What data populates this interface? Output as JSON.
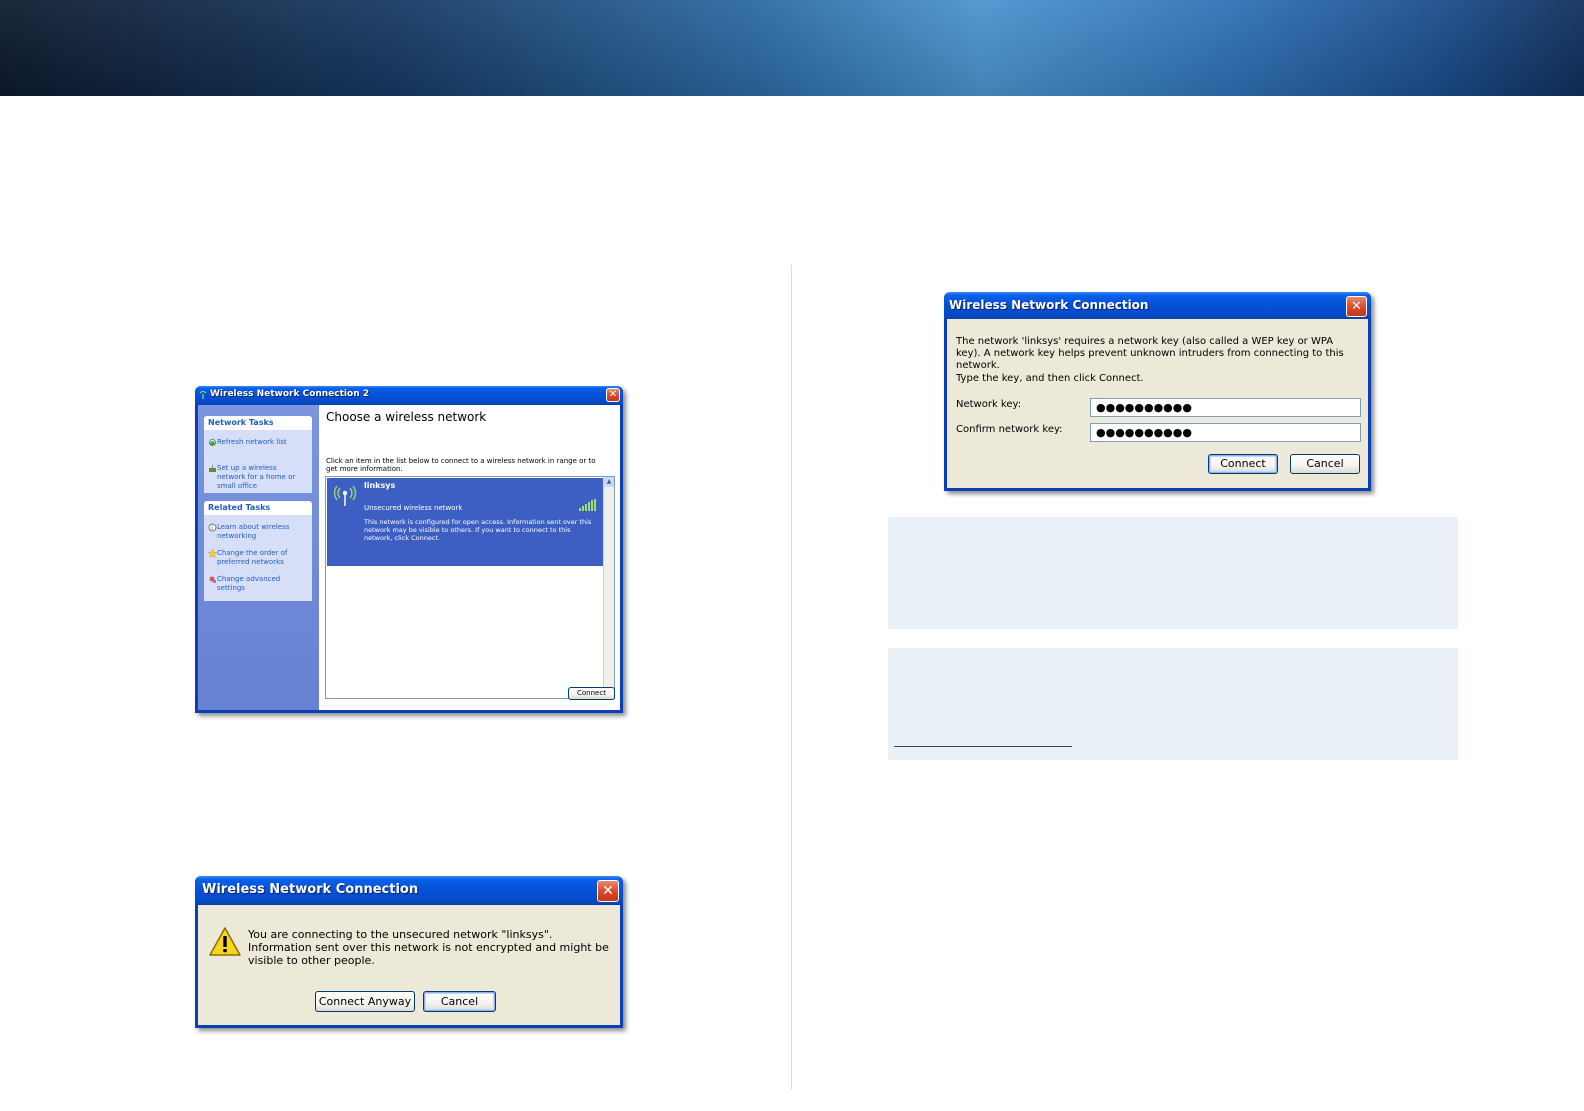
{
  "win1": {
    "title": "Wireless Network Connection 2",
    "close": "✕",
    "network_tasks": {
      "header": "Network Tasks",
      "items": [
        {
          "icon": "refresh-icon",
          "label": "Refresh network list"
        },
        {
          "icon": "wireless-setup-icon",
          "label": "Set up a wireless network for a home or small office"
        }
      ]
    },
    "related_tasks": {
      "header": "Related Tasks",
      "items": [
        {
          "icon": "info-icon",
          "label": "Learn about wireless networking"
        },
        {
          "icon": "star-icon",
          "label": "Change the order of preferred networks"
        },
        {
          "icon": "settings-icon",
          "label": "Change advanced settings"
        }
      ]
    },
    "heading": "Choose a wireless network",
    "instructions": "Click an item in the list below to connect to a wireless network in range or to get more information.",
    "network": {
      "name": "linksys",
      "status": "Unsecured wireless network",
      "description": "This network is configured for open access. Information sent over this network may be visible to others. If you want to connect to this network, click Connect."
    },
    "connect_button": "Connect",
    "colors": {
      "selected": "#3d5fc4",
      "task_pane": "#7a96df",
      "link": "#215dc6"
    }
  },
  "win2": {
    "title": "Wireless Network Connection",
    "close": "✕",
    "message": "You are connecting to the unsecured network \"linksys\". Information sent over this network is not encrypted and might be visible to other people.",
    "connect_anyway": "Connect Anyway",
    "cancel": "Cancel"
  },
  "win3": {
    "title": "Wireless Network Connection",
    "close": "✕",
    "message": "The network 'linksys' requires a network key (also called a WEP key or WPA key). A network key helps prevent unknown intruders from connecting to this network.",
    "instruction": "Type the key, and then click Connect.",
    "key_label": "Network key:",
    "confirm_label": "Confirm network key:",
    "key_value": "●●●●●●●●●●",
    "confirm_value": "●●●●●●●●●●",
    "connect": "Connect",
    "cancel": "Cancel"
  }
}
